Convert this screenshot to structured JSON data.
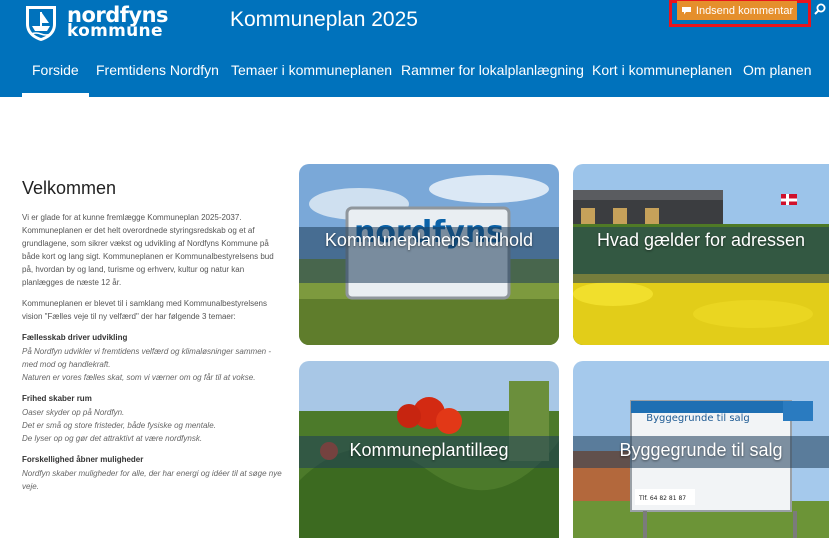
{
  "header": {
    "logo_line1": "nordfyns",
    "logo_line2": "kommune",
    "site_title": "Kommuneplan 2025",
    "comment_button": "Indsend kommentar",
    "search_icon": "search-icon"
  },
  "nav": [
    {
      "label": "Forside",
      "active": true
    },
    {
      "label": "Fremtidens Nordfyn"
    },
    {
      "label": "Temaer i kommuneplanen"
    },
    {
      "label": "Rammer for lokalplanlægning"
    },
    {
      "label": "Kort i kommuneplanen"
    },
    {
      "label": "Om planen"
    }
  ],
  "intro": {
    "heading": "Velkommen",
    "para1": "Vi er glade for at kunne fremlægge Kommuneplan 2025-2037. Kommuneplanen er det helt overordnede styringsredskab og et af grundlagene, som sikrer vækst og udvikling af Nordfyns Kommune på både kort og lang sigt. Kommuneplanen er Kommunalbestyrelsens bud på, hvordan by og land, turisme og erhverv, kultur og natur kan planlægges de næste 12 år.",
    "para2": "Kommuneplanen er blevet til i samklang med Kommunalbestyrelsens vision \"Fælles veje til ny velfærd\" der har følgende 3 temaer:",
    "themes": [
      {
        "title": "Fællesskab driver udvikling",
        "text": "På Nordfyn udvikler vi fremtidens velfærd og klimaløsninger sammen - med mod og handlekraft.\nNaturen er vores fælles skat, som vi værner om og får til at vokse."
      },
      {
        "title": "Frihed skaber rum",
        "text": "Oaser skyder op på Nordfyn.\nDet er små og store fristeder, både fysiske og mentale.\nDe lyser op og gør det attraktivt at være nordfynsk."
      },
      {
        "title": "Forskellighed åbner muligheder",
        "text": "Nordfyn skaber muligheder for alle, der har energi og idéer til at søge nye veje."
      }
    ]
  },
  "tiles": [
    {
      "caption": "Kommuneplanens indhold",
      "sign_text": "nordfyns"
    },
    {
      "caption": "Hvad gælder for adressen"
    },
    {
      "caption": "Kommuneplantillæg"
    },
    {
      "caption": "Byggegrunde til salg",
      "sign_title": "Byggegrunde til salg",
      "sign_phone": "Tlf. 64 82 81 87"
    }
  ],
  "colors": {
    "brand_blue": "#0072bc",
    "accent_orange": "#e58f2c",
    "highlight_red": "#e8141c"
  }
}
